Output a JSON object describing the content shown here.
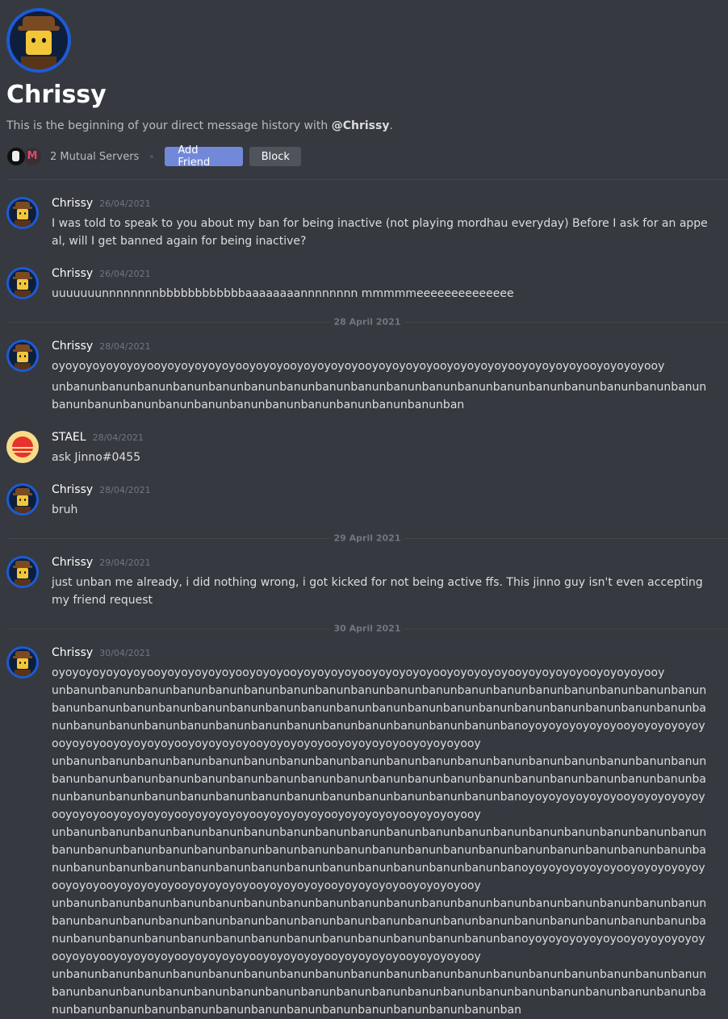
{
  "header": {
    "name": "Chrissy",
    "desc_prefix": "This is the beginning of your direct message history with ",
    "desc_handle": "@Chrissy",
    "desc_suffix": ".",
    "mutual_servers": "2 Mutual Servers",
    "add_friend": "Add Friend",
    "block": "Block",
    "mutual_icon_2_letter": "M"
  },
  "dates": {
    "d1": "28 April 2021",
    "d2": "29 April 2021",
    "d3": "30 April 2021"
  },
  "messages": [
    {
      "author": "Chrissy",
      "time": "26/04/2021",
      "lines": [
        "I was told to speak to you about my ban for being inactive (not playing mordhau everyday) Before I ask for an appeal, will I get banned again for being inactive?"
      ]
    },
    {
      "author": "Chrissy",
      "time": "26/04/2021",
      "lines": [
        "uuuuuuunnnnnnnnbbbbbbbbbbbbaaaaaaaannnnnnnn mmmmmeeeeeeeeeeeeee"
      ]
    },
    {
      "author": "Chrissy",
      "time": "28/04/2021",
      "lines": [
        "oyoyoyoyoyoyoyooyoyoyoyoyoyooyoyoyooyoyoyoyoyooyoyoyoyoyooyoyoyoyoyooyoyoyoyoyooyoyoyoyooy",
        "unbanunbanunbanunbanunbanunbanunbanunbanunbanunbanunbanunbanunbanunbanunbanunbanunbanunbanunbanunbanunbanunbanunbanunbanunbanunbanunbanunbanunbanunban"
      ]
    },
    {
      "author": "STAEL",
      "time": "28/04/2021",
      "lines": [
        "ask Jinno#0455"
      ]
    },
    {
      "author": "Chrissy",
      "time": "28/04/2021",
      "lines": [
        "bruh"
      ]
    },
    {
      "author": "Chrissy",
      "time": "29/04/2021",
      "lines": [
        "just unban me already, i did nothing wrong, i got kicked for not being active ffs. This jinno guy isn't even accepting my friend request"
      ]
    },
    {
      "author": "Chrissy",
      "time": "30/04/2021",
      "lines": [
        "oyoyoyoyoyoyoyooyoyoyoyoyoyooyoyoyooyoyoyoyoyooyoyoyoyoyooyoyoyoyoyooyoyoyoyoyooyoyoyoyooy",
        "unbanunbanunbanunbanunbanunbanunbanunbanunbanunbanunbanunbanunbanunbanunbanunbanunbanunbanunbanunbanunbanunbanunbanunbanunbanunbanunbanunbanunbanunbanunbanunbanunbanunbanunbanunbanunbanunbanunbanunbanunbanunbanunbanunbanunbanunbanunbanunbanunbanunbanoyoyoyoyoyoyoyooyoyoyoyoyoyooyoyoyooyoyoyoyoyooyoyoyoyoyooyoyoyoyoyooyoyoyoyoyooyoyoyoyooy",
        "unbanunbanunbanunbanunbanunbanunbanunbanunbanunbanunbanunbanunbanunbanunbanunbanunbanunbanunbanunbanunbanunbanunbanunbanunbanunbanunbanunbanunbanunbanunbanunbanunbanunbanunbanunbanunbanunbanunbanunbanunbanunbanunbanunbanunbanunbanunbanunbanunbanunbanoyoyoyoyoyoyoyooyoyoyoyoyoyooyoyoyooyoyoyoyoyooyoyoyoyoyooyoyoyoyoyooyoyoyoyoyooyoyoyoyooy",
        "unbanunbanunbanunbanunbanunbanunbanunbanunbanunbanunbanunbanunbanunbanunbanunbanunbanunbanunbanunbanunbanunbanunbanunbanunbanunbanunbanunbanunbanunbanunbanunbanunbanunbanunbanunbanunbanunbanunbanunbanunbanunbanunbanunbanunbanunbanunbanunbanunbanunbanoyoyoyoyoyoyoyooyoyoyoyoyoyooyoyoyooyoyoyoyoyooyoyoyoyoyooyoyoyoyoyooyoyoyoyoyooyoyoyoyooy",
        "unbanunbanunbanunbanunbanunbanunbanunbanunbanunbanunbanunbanunbanunbanunbanunbanunbanunbanunbanunbanunbanunbanunbanunbanunbanunbanunbanunbanunbanunbanunbanunbanunbanunbanunbanunbanunbanunbanunbanunbanunbanunbanunbanunbanunbanunbanunbanunbanunbanunbanoyoyoyoyoyoyoyooyoyoyoyoyoyooyoyoyooyoyoyoyoyooyoyoyoyoyooyoyoyoyoyooyoyoyoyoyooyoyoyoyooy",
        "unbanunbanunbanunbanunbanunbanunbanunbanunbanunbanunbanunbanunbanunbanunbanunbanunbanunbanunbanunbanunbanunbanunbanunbanunbanunbanunbanunbanunbanunbanunbanunbanunbanunbanunbanunbanunbanunbanunbanunbanunbanunbanunbanunbanunbanunbanunbanunbanunbanunban"
      ]
    }
  ]
}
